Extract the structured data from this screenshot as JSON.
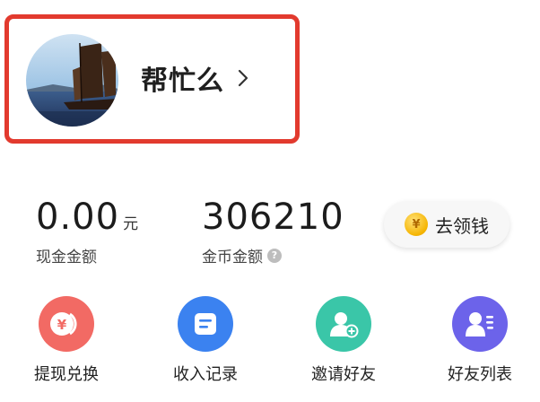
{
  "profile": {
    "username": "帮忙么",
    "avatar_icon": "sailboat-photo"
  },
  "stats": {
    "cash": {
      "value": "0.00",
      "unit": "元",
      "label": "现金金额"
    },
    "coins": {
      "value": "306210",
      "label": "金币金额",
      "help_icon": "question-icon"
    }
  },
  "withdraw": {
    "label": "去领钱",
    "icon": "coin-icon",
    "coin_glyph": "¥"
  },
  "actions": [
    {
      "label": "提现兑换",
      "icon": "yuan-exchange-icon",
      "color": "#f26a64"
    },
    {
      "label": "收入记录",
      "icon": "record-list-icon",
      "color": "#3b82f0"
    },
    {
      "label": "邀请好友",
      "icon": "invite-user-icon",
      "color": "#3ac6a8"
    },
    {
      "label": "好友列表",
      "icon": "friend-list-icon",
      "color": "#6c63ea"
    }
  ],
  "colors": {
    "highlight_border": "#e23a2e"
  }
}
